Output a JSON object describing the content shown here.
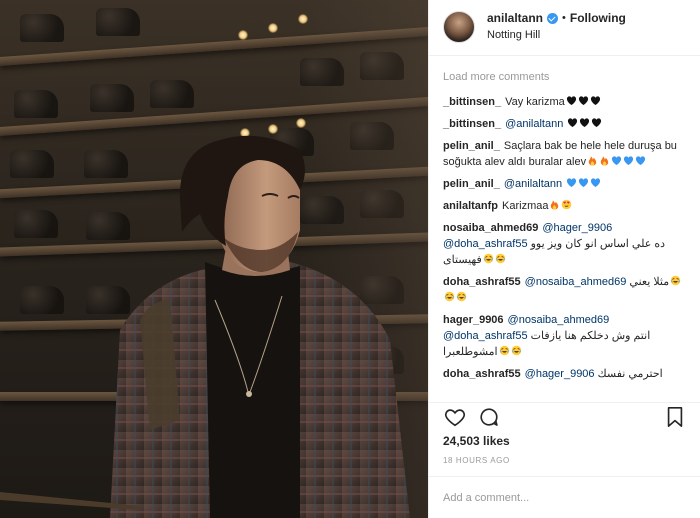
{
  "header": {
    "username": "anilaltann",
    "separator": "•",
    "follow_label": "Following",
    "location": "Notting Hill"
  },
  "load_more_label": "Load more comments",
  "comments": [
    {
      "user": "_bittinsen_",
      "text": "Vay karizma",
      "emoji": [
        "heart-black",
        "heart-black",
        "heart-black"
      ]
    },
    {
      "user": "_bittinsen_",
      "mention": "@anilaltann",
      "text": "",
      "emoji": [
        "heart-black",
        "heart-black",
        "heart-black"
      ]
    },
    {
      "user": "pelin_anil_",
      "text": "Saçlara bak be hele hele duruşa bu soğukta alev aldı buralar alev",
      "emoji": [
        "fire",
        "fire",
        "heart-blue",
        "heart-blue",
        "heart-blue"
      ]
    },
    {
      "user": "pelin_anil_",
      "mention": "@anilaltann",
      "text": "",
      "emoji": [
        "heart-blue",
        "heart-blue",
        "heart-blue"
      ]
    },
    {
      "user": "anilaltanfp",
      "text": "Karizmaa",
      "emoji": [
        "fire",
        "heart-eyes"
      ]
    },
    {
      "user": "nosaiba_ahmed69",
      "mention": "@hager_9906",
      "rtl_mention": "@doha_ashraf55",
      "text": "ده علي اساس انو كان ويز يوو فهيستاى",
      "emoji": [
        "laugh",
        "laugh"
      ]
    },
    {
      "user": "doha_ashraf55",
      "mention": "@nosaiba_ahmed69",
      "text": "مثلا يعني",
      "emoji": [
        "laugh",
        "laugh",
        "laugh"
      ]
    },
    {
      "user": "hager_9906",
      "mention": "@nosaiba_ahmed69",
      "rtl_mention": "@doha_ashraf55",
      "text": "انتم وش دخلكم هنا يازفات امشوطلعبرا",
      "emoji": [
        "laugh",
        "laugh"
      ]
    },
    {
      "user": "doha_ashraf55",
      "mention": "@hager_9906",
      "text": "احترمي نفسك",
      "emoji": []
    }
  ],
  "likes": "24,503 likes",
  "time_ago": "18 HOURS AGO",
  "add_comment_placeholder": "Add a comment...",
  "icons": {
    "like": "heart-outline-icon",
    "comment": "speech-bubble-icon",
    "save": "bookmark-icon",
    "verified": "verified-badge-icon"
  },
  "colors": {
    "verified": "#3897f0",
    "mention": "#003569",
    "muted": "#999999",
    "text": "#262626",
    "blue_heart": "#3897f0",
    "fire": "#f2711c"
  }
}
